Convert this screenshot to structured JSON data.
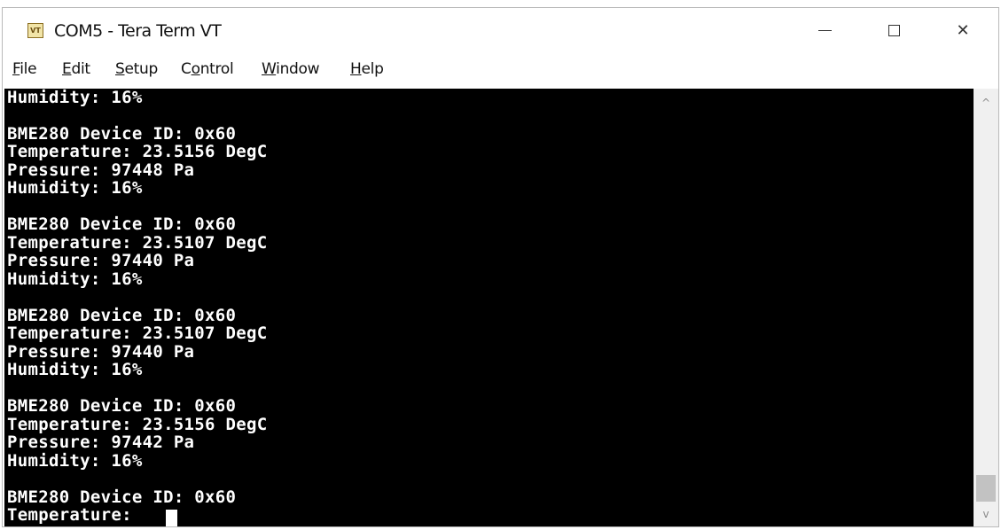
{
  "window": {
    "title": "COM5 - Tera Term VT",
    "icon_text": "VT",
    "controls": {
      "minimize": "minimize-icon",
      "maximize": "maximize-icon",
      "close": "close-icon"
    },
    "close_glyph": "✕"
  },
  "menu": [
    {
      "key": "F",
      "rest": "ile"
    },
    {
      "key": "E",
      "rest": "dit"
    },
    {
      "key": "S",
      "rest": "etup"
    },
    {
      "pre": "C",
      "key": "o",
      "rest": "ntrol"
    },
    {
      "key": "W",
      "rest": "indow"
    },
    {
      "key": "H",
      "rest": "elp"
    }
  ],
  "terminal": {
    "background": "#000000",
    "foreground": "#ffffff",
    "lines": [
      "Humidity: 16%",
      "",
      "BME280 Device ID: 0x60",
      "Temperature: 23.5156 DegC",
      "Pressure: 97448 Pa",
      "Humidity: 16%",
      "",
      "BME280 Device ID: 0x60",
      "Temperature: 23.5107 DegC",
      "Pressure: 97440 Pa",
      "Humidity: 16%",
      "",
      "BME280 Device ID: 0x60",
      "Temperature: 23.5107 DegC",
      "Pressure: 97440 Pa",
      "Humidity: 16%",
      "",
      "BME280 Device ID: 0x60",
      "Temperature: 23.5156 DegC",
      "Pressure: 97442 Pa",
      "Humidity: 16%",
      "",
      "BME280 Device ID: 0x60",
      "Temperature:"
    ]
  },
  "scrollbar": {
    "up_glyph": "^",
    "down_glyph": "v"
  }
}
